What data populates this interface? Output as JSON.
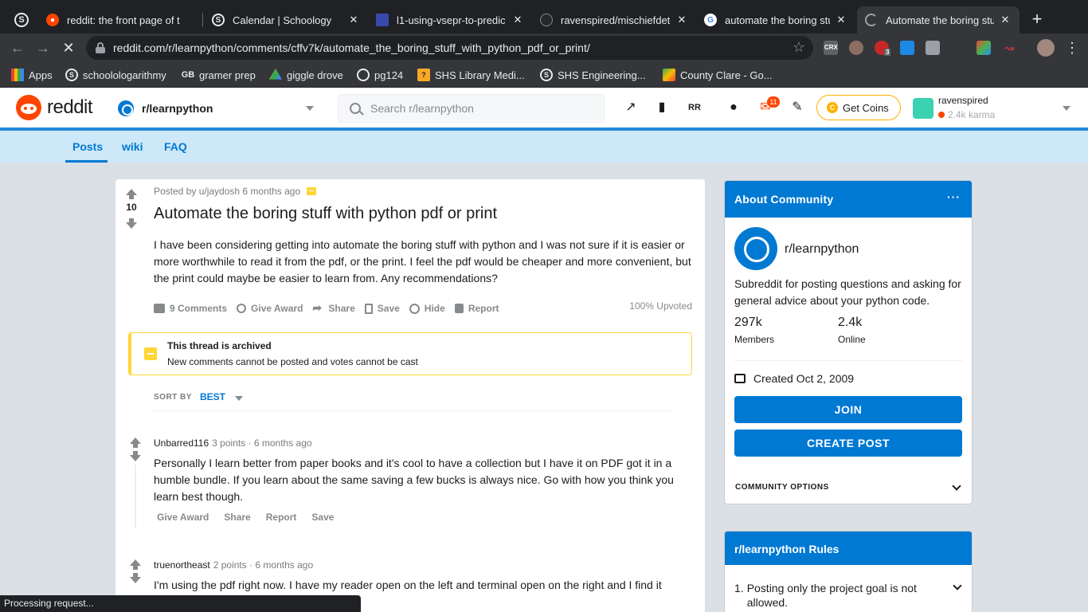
{
  "browser": {
    "tabs": [
      {
        "title": "reddit: the front page of t",
        "icon": "reddit-icon",
        "color": "#ff4500"
      },
      {
        "title": "Calendar | Schoology",
        "icon": "schoology-icon",
        "color": "#1a73e8"
      },
      {
        "title": "l1-using-vsepr-to-predic",
        "icon": "doc-icon",
        "color": "#5e35b1"
      },
      {
        "title": "ravenspired/mischiefdete",
        "icon": "github-icon",
        "color": "#24292e"
      },
      {
        "title": "automate the boring stuf",
        "icon": "google-icon",
        "color": "#ffffff"
      },
      {
        "title": "Automate the boring stuf",
        "icon": "loading-icon",
        "color": "#35363a"
      }
    ],
    "new_tab": "+",
    "url": "reddit.com/r/learnpython/comments/cffv7k/automate_the_boring_stuff_with_python_pdf_or_print/",
    "bookmarks": [
      {
        "label": "Apps",
        "icon": "apps-grid-icon"
      },
      {
        "label": "schoolologarithmy",
        "icon": "schoology-icon"
      },
      {
        "label": "gramer prep",
        "icon": "gb-icon"
      },
      {
        "label": "giggle drove",
        "icon": "drive-icon"
      },
      {
        "label": "pg124",
        "icon": "globe-icon"
      },
      {
        "label": "SHS Library Medi...",
        "icon": "library-icon"
      },
      {
        "label": "SHS Engineering...",
        "icon": "schoology-icon"
      },
      {
        "label": "County Clare - Go...",
        "icon": "maps-icon"
      }
    ],
    "extension_labels": {
      "crx": "CRX",
      "abp_count": "3"
    },
    "status": "Processing request..."
  },
  "header": {
    "wordmark": "reddit",
    "subreddit": "r/learnpython",
    "search_placeholder": "Search r/learnpython",
    "notifications_count": "11",
    "coins_label": "Get Coins",
    "username": "ravenspired",
    "karma": "2.4k karma"
  },
  "subnav": {
    "tabs": [
      "Posts",
      "wiki",
      "FAQ"
    ]
  },
  "post": {
    "author": "Posted by u/jaydosh",
    "age": "6 months ago",
    "score": "10",
    "title": "Automate the boring stuff with python pdf or print",
    "body": "I have been considering getting into automate the boring stuff with python and I was not sure if it is easier or more worthwhile to read it from the pdf, or the print. I feel the pdf would be cheaper and more convenient, but the print could maybe be easier to learn from. Any recommendations?",
    "actions": [
      "9 Comments",
      "Give Award",
      "Share",
      "Save",
      "Hide",
      "Report"
    ],
    "upvoted": "100% Upvoted",
    "archived_title": "This thread is archived",
    "archived_sub": "New comments cannot be posted and votes cannot be cast",
    "sort_label": "SORT BY",
    "sort_value": "BEST"
  },
  "comments": [
    {
      "author": "Unbarred116",
      "meta": "3 points · 6 months ago",
      "body": "Personally I learn better from paper books and it's cool to have a collection but I have it on PDF got it in a humble bundle. If you learn about the same saving a few bucks is always nice. Go with how you think you learn best though.",
      "actions": [
        "Give Award",
        "Share",
        "Report",
        "Save"
      ]
    },
    {
      "author": "truenortheast",
      "meta": "2 points · 6 months ago",
      "body": "I'm using the pdf right now. I have my reader open on the left and terminal open on the right and I find it pretty convenient."
    }
  ],
  "sidebar": {
    "about_title": "About Community",
    "more": "···",
    "name": "r/learnpython",
    "description": "Subreddit for posting questions and asking for general advice about your python code.",
    "members_count": "297k",
    "members_label": "Members",
    "online_count": "2.4k",
    "online_label": "Online",
    "created": "Created Oct 2, 2009",
    "join": "JOIN",
    "create_post": "CREATE POST",
    "community_options": "COMMUNITY OPTIONS",
    "rules_title": "r/learnpython Rules",
    "rule1_num": "1.",
    "rule1_text": "Posting only the project goal is not allowed."
  },
  "colors": {
    "accent": "#0079d3",
    "orangered": "#ff4500",
    "archive": "#ffd635",
    "coins": "#ffb000"
  }
}
